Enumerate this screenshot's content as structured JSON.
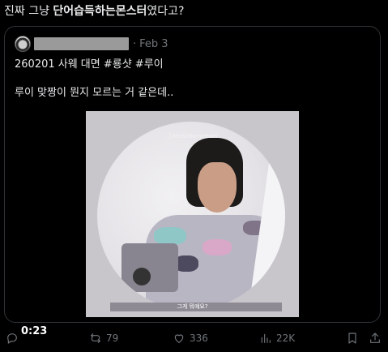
{
  "post": {
    "text_part1": "진짜 그냥 ",
    "text_bold": "단어습득하는몬스터",
    "text_part2": "였다고?"
  },
  "quote": {
    "author_name": "",
    "separator": "·",
    "date": "Feb 3",
    "line1": "260201 사웨 대면 #룡샷 #루이",
    "line2": "루이 맞짱이 뭔지 모르는 거 같은데..",
    "media": {
      "duration": "0:23",
      "subtitle": "그게 뭐예요?",
      "watermark": "ⓒMoistHomeRam"
    }
  },
  "actions": {
    "reply": {
      "icon": "reply-icon",
      "count": ""
    },
    "repost": {
      "icon": "repost-icon",
      "count": "79"
    },
    "like": {
      "icon": "heart-icon",
      "count": "336"
    },
    "views": {
      "icon": "views-icon",
      "count": "22K"
    },
    "bookmark": {
      "icon": "bookmark-icon"
    },
    "share": {
      "icon": "share-icon"
    }
  },
  "colors": {
    "background": "#000000",
    "text": "#e7e9ea",
    "muted": "#71767b",
    "border": "#2f3336"
  }
}
